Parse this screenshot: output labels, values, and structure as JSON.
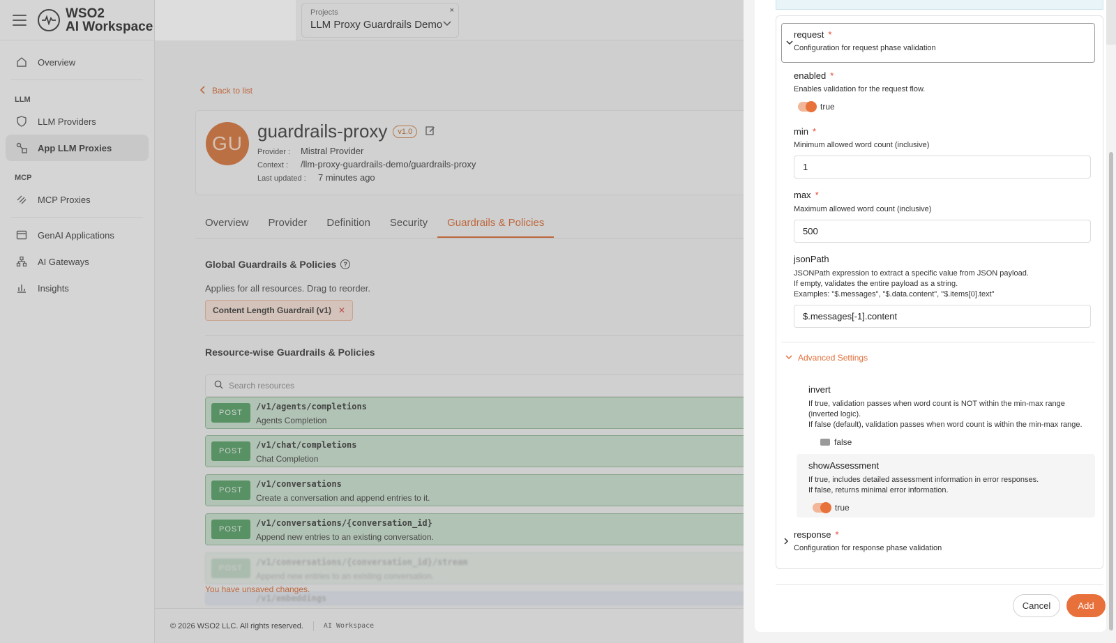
{
  "brand": {
    "line1": "WSO2",
    "line2": "AI Workspace"
  },
  "topbar": {
    "project_label": "Projects",
    "project_value": "LLM Proxy Guardrails Demo",
    "close": "×",
    "chevron": "⌄"
  },
  "sidebar": {
    "overview": "Overview",
    "llm_section": "LLM",
    "llm_providers": "LLM Providers",
    "app_llm_proxies": "App LLM Proxies",
    "mcp_section": "MCP",
    "mcp_proxies": "MCP Proxies",
    "genai_apps": "GenAI Applications",
    "ai_gateways": "AI Gateways",
    "insights": "Insights"
  },
  "main": {
    "back": "Back to list",
    "avatar": "GU",
    "proxy_name": "guardrails-proxy",
    "version": "v1.0",
    "provider_key": "Provider :",
    "provider_val": "Mistral Provider",
    "context_key": "Context :",
    "context_val": "/llm-proxy-guardrails-demo/guardrails-proxy",
    "updated_key": "Last updated :",
    "updated_val": "7 minutes ago",
    "tabs": [
      "Overview",
      "Provider",
      "Definition",
      "Security",
      "Guardrails & Policies"
    ],
    "global_title": "Global Guardrails & Policies",
    "global_sub": "Applies for all resources. Drag to reorder.",
    "chip": "Content Length Guardrail (v1)",
    "resource_title": "Resource-wise Guardrails & Policies",
    "search_placeholder": "Search resources",
    "resources": [
      {
        "method": "POST",
        "path": "/v1/agents/completions",
        "desc": "Agents Completion"
      },
      {
        "method": "POST",
        "path": "/v1/chat/completions",
        "desc": "Chat Completion"
      },
      {
        "method": "POST",
        "path": "/v1/conversations",
        "desc": "Create a conversation and append entries to it."
      },
      {
        "method": "POST",
        "path": "/v1/conversations/{conversation_id}",
        "desc": "Append new entries to an existing conversation."
      },
      {
        "method": "POST",
        "path": "/v1/conversations/{conversation_id}/stream",
        "desc": "Append new entries to an existing conversation."
      },
      {
        "method": "",
        "path": "/v1/embeddings",
        "desc": ""
      }
    ],
    "unsaved": "You have unsaved changes.",
    "footer_copy": "© 2026 WSO2 LLC. All rights reserved.",
    "footer_tag": "AI Workspace"
  },
  "drawer": {
    "request": {
      "label": "request",
      "req": "*",
      "desc": "Configuration for request phase validation"
    },
    "enabled": {
      "label": "enabled",
      "req": "*",
      "desc": "Enables validation for the request flow.",
      "value": "true"
    },
    "min": {
      "label": "min",
      "req": "*",
      "desc": "Minimum allowed word count (inclusive)",
      "value": "1"
    },
    "max": {
      "label": "max",
      "req": "*",
      "desc": "Maximum allowed word count (inclusive)",
      "value": "500"
    },
    "jsonPath": {
      "label": "jsonPath",
      "desc1": "JSONPath expression to extract a specific value from JSON payload.",
      "desc2": "If empty, validates the entire payload as a string.",
      "desc3": "Examples: \"$.messages\", \"$.data.content\", \"$.items[0].text\"",
      "value": "$.messages[-1].content"
    },
    "advanced": "Advanced Settings",
    "invert": {
      "label": "invert",
      "desc1": "If true, validation passes when word count is NOT within the min-max range",
      "desc2": "(inverted logic).",
      "desc3": "If false (default), validation passes when word count is within the min-max range.",
      "value": "false"
    },
    "showAssessment": {
      "label": "showAssessment",
      "desc1": "If true, includes detailed assessment information in error responses.",
      "desc2": "If false, returns minimal error information.",
      "value": "true"
    },
    "response": {
      "label": "response",
      "req": "*",
      "desc": "Configuration for response phase validation"
    },
    "cancel": "Cancel",
    "add": "Add"
  },
  "colors": {
    "accent": "#e8703a",
    "required": "#e0452b",
    "post_green": "#4e9a5e"
  }
}
